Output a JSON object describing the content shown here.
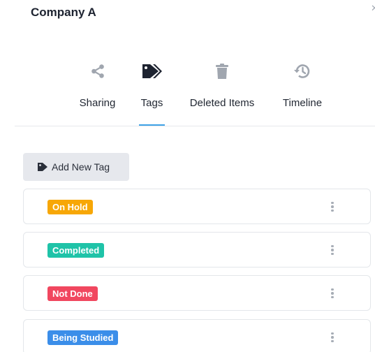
{
  "panel": {
    "title": "Company A"
  },
  "tabs": [
    {
      "label": "Sharing",
      "icon": "share-icon"
    },
    {
      "label": "Tags",
      "icon": "tags-icon",
      "active": true
    },
    {
      "label": "Deleted Items",
      "icon": "trash-icon"
    },
    {
      "label": "Timeline",
      "icon": "history-icon"
    }
  ],
  "toolbar": {
    "add_label": "Add New Tag",
    "add_icon": "tag-icon"
  },
  "tags": [
    {
      "label": "On Hold",
      "color": "#f7a707"
    },
    {
      "label": "Completed",
      "color": "#1fc3a8"
    },
    {
      "label": "Not Done",
      "color": "#f1475f"
    },
    {
      "label": "Being Studied",
      "color": "#3b8ee9"
    }
  ],
  "colors": {
    "active_underline": "#3fa3e6",
    "icon_inactive": "#a0a6af",
    "icon_active": "#1d2330"
  }
}
